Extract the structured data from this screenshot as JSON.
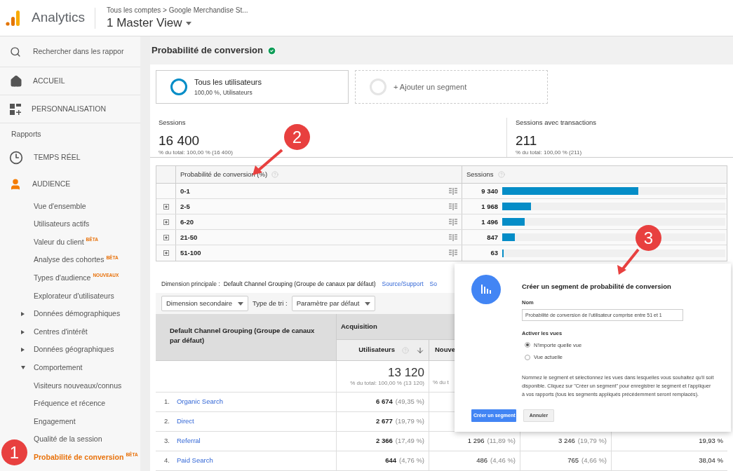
{
  "header": {
    "product": "Analytics",
    "breadcrumb": "Tous les comptes > Google Merchandise St...",
    "view": "1 Master View"
  },
  "sidebar": {
    "search_placeholder": "Rechercher dans les rappor",
    "top_items": [
      {
        "label": "ACCUEIL"
      },
      {
        "label": "PERSONNALISATION"
      }
    ],
    "reports_heading": "Rapports",
    "report_items": [
      {
        "label": "TEMPS RÉEL",
        "selected": false
      },
      {
        "label": "AUDIENCE",
        "selected": true,
        "children": [
          {
            "kind": "leaf",
            "label": "Vue d'ensemble",
            "selected": false
          },
          {
            "kind": "leaf",
            "label": "Utilisateurs actifs",
            "selected": false
          },
          {
            "kind": "leaf",
            "label": "Valeur du client",
            "badge": "BÊTA",
            "selected": false
          },
          {
            "kind": "leaf",
            "label": "Analyse des cohortes",
            "badge": "BÊTA",
            "selected": false
          },
          {
            "kind": "leaf",
            "label": "Types d'audience",
            "badge": "NOUVEAUX",
            "selected": false
          },
          {
            "kind": "leaf",
            "label": "Explorateur d'utilisateurs",
            "selected": false
          },
          {
            "kind": "group",
            "label": "Données démographiques",
            "expanded": false,
            "selected": false
          },
          {
            "kind": "group",
            "label": "Centres d'intérêt",
            "expanded": false,
            "selected": false
          },
          {
            "kind": "group",
            "label": "Données géographiques",
            "expanded": false,
            "selected": false
          },
          {
            "kind": "group",
            "label": "Comportement",
            "expanded": true,
            "selected": false,
            "children": [
              {
                "kind": "leaf",
                "label": "Visiteurs nouveaux/connus",
                "selected": false
              },
              {
                "kind": "leaf",
                "label": "Fréquence et récence",
                "selected": false
              },
              {
                "kind": "leaf",
                "label": "Engagement",
                "selected": false
              },
              {
                "kind": "leaf",
                "label": "Qualité de la session",
                "selected": false
              },
              {
                "kind": "leaf",
                "label": "Probabilité de conversion",
                "badge": "BÊTA",
                "selected": true
              }
            ]
          }
        ]
      }
    ]
  },
  "page_title": "Probabilité de conversion",
  "segments": [
    {
      "kind": "active",
      "title": "Tous les utilisateurs",
      "subtitle": "100,00 %, Utilisateurs"
    },
    {
      "kind": "add",
      "title": "+ Ajouter un segment"
    }
  ],
  "metrics": [
    {
      "label": "Sessions",
      "value": "16 400",
      "total": "% du total: 100,00 % (16 400)"
    },
    {
      "label": "Sessions avec transactions",
      "value": "211",
      "total": "% du total: 100,00 % (211)"
    }
  ],
  "probability_table": {
    "columns": [
      "Probabilité de conversion (%)",
      "Sessions"
    ],
    "rows": [
      {
        "range": "0-1",
        "expandable": false,
        "sessions": "9 340",
        "level": 0.61
      },
      {
        "range": "2-5",
        "expandable": true,
        "sessions": "1 968",
        "level": 0.13
      },
      {
        "range": "6-20",
        "expandable": true,
        "sessions": "1 496",
        "level": 0.1
      },
      {
        "range": "21-50",
        "expandable": true,
        "sessions": "847",
        "level": 0.056
      },
      {
        "range": "51-100",
        "expandable": true,
        "sessions": "63",
        "level": 0.005
      }
    ]
  },
  "report": {
    "primary_label": "Dimension principale :",
    "primary_value": "Default Channel Grouping (Groupe de canaux par défaut)",
    "links": [
      "Source/Support",
      "So"
    ],
    "secondary_dimension": "Dimension secondaire",
    "sort_label": "Type de tri :",
    "sort_value": "Paramètre par défaut",
    "dimension_header": "Default Channel Grouping (Groupe de canaux par défaut)",
    "group_header": "Acquisition",
    "columns": [
      "Utilisateurs",
      "Nouve"
    ],
    "totals": [
      {
        "value": "13 120",
        "total": "% du total: 100,00 % (13 120)"
      },
      {
        "total": "% du t"
      }
    ],
    "rows": [
      {
        "index": "1.",
        "name": "Organic Search",
        "cells": [
          {
            "value": "6 674",
            "pct": "(49,35 %)"
          }
        ]
      },
      {
        "index": "2.",
        "name": "Direct",
        "cells": [
          {
            "value": "2 677",
            "pct": "(19,79 %)"
          }
        ]
      },
      {
        "index": "3.",
        "name": "Referral",
        "cells": [
          {
            "value": "2 366",
            "pct": "(17,49 %)"
          },
          {
            "value": "1 296",
            "pct": "(11,89 %)"
          },
          {
            "value": "3 246",
            "pct": "(19,79 %)"
          },
          {
            "value": "19,93 %"
          }
        ]
      },
      {
        "index": "4.",
        "name": "Paid Search",
        "cells": [
          {
            "value": "644",
            "pct": "(4,76 %)"
          },
          {
            "value": "486",
            "pct": "(4,46 %)"
          },
          {
            "value": "765",
            "pct": "(4,66 %)"
          },
          {
            "value": "38,04 %"
          }
        ]
      }
    ]
  },
  "dialog": {
    "title": "Créer un segment de probabilité de conversion",
    "name_label": "Nom",
    "name_value": "Probabilité de conversion de l'utilisateur comprise entre 51 et 1",
    "views_label": "Activer les vues",
    "options": [
      {
        "label": "N'importe quelle vue",
        "selected": true
      },
      {
        "label": "Vue actuelle",
        "selected": false
      }
    ],
    "help": "Nommez le segment et sélectionnez les vues dans lesquelles vous souhaitez qu'il soit disponible. Cliquez sur \"Créer un segment\" pour enregistrer le segment et l'appliquer à vos rapports (tous les segments appliqués précédemment seront remplacés).",
    "buttons": [
      {
        "kind": "primary",
        "label": "Créer un segment"
      },
      {
        "kind": "secondary",
        "label": "Annuler"
      }
    ]
  },
  "annotations": [
    {
      "label": "1"
    },
    {
      "label": "2"
    },
    {
      "label": "3"
    }
  ]
}
